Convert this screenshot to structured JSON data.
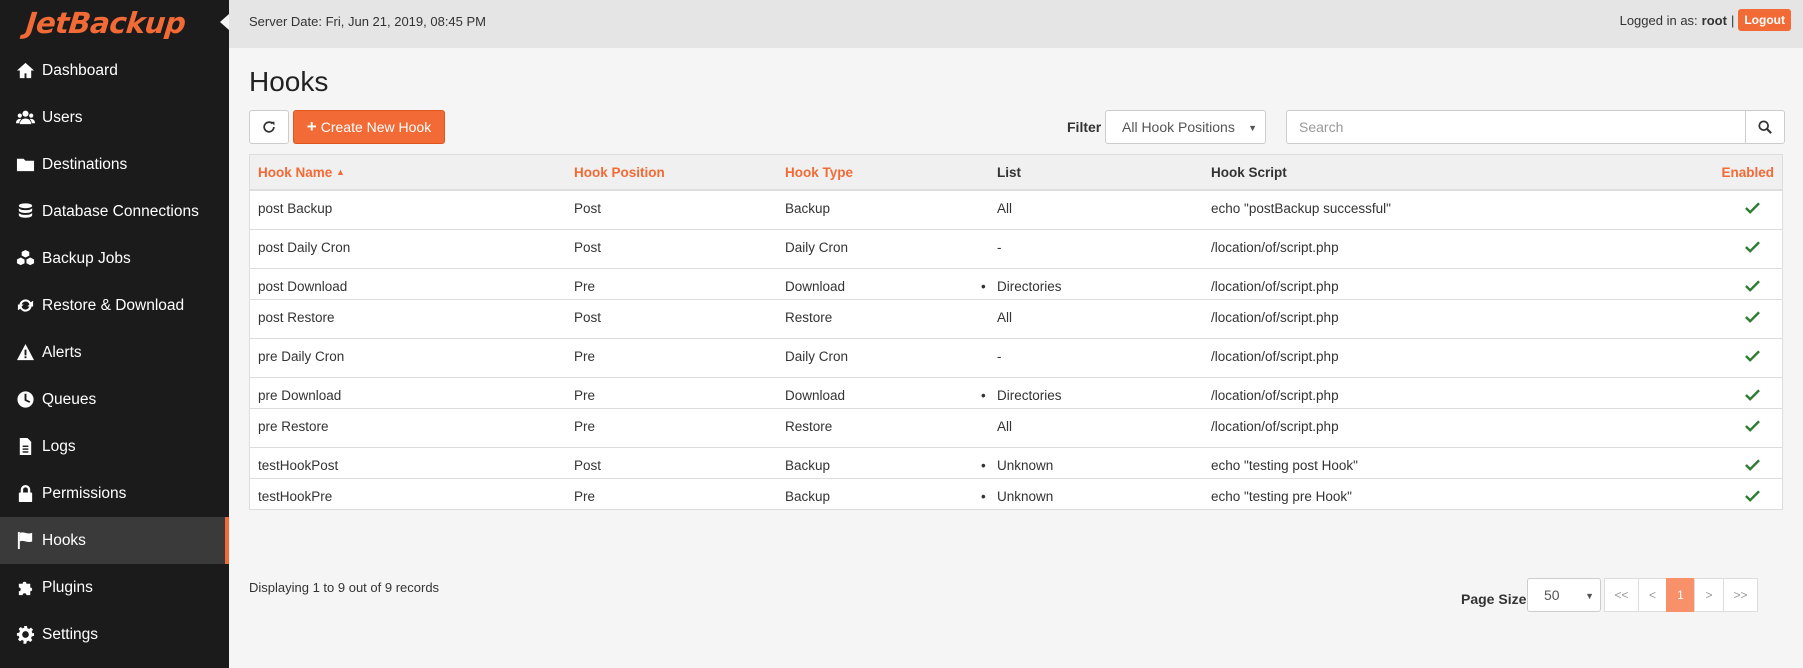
{
  "app": {
    "logo": "JetBackup"
  },
  "sidebar": {
    "items": [
      {
        "label": "Dashboard",
        "icon": "home-icon"
      },
      {
        "label": "Users",
        "icon": "users-icon"
      },
      {
        "label": "Destinations",
        "icon": "folder-icon"
      },
      {
        "label": "Database Connections",
        "icon": "database-icon"
      },
      {
        "label": "Backup Jobs",
        "icon": "cubes-icon"
      },
      {
        "label": "Restore & Download",
        "icon": "refresh-icon"
      },
      {
        "label": "Alerts",
        "icon": "warning-icon"
      },
      {
        "label": "Queues",
        "icon": "clock-icon"
      },
      {
        "label": "Logs",
        "icon": "file-icon"
      },
      {
        "label": "Permissions",
        "icon": "lock-icon"
      },
      {
        "label": "Hooks",
        "icon": "flag-icon",
        "active": true
      },
      {
        "label": "Plugins",
        "icon": "puzzle-icon"
      },
      {
        "label": "Settings",
        "icon": "gear-icon"
      }
    ]
  },
  "topbar": {
    "server_date": "Server Date: Fri, Jun 21, 2019, 08:45 PM",
    "logged_in_label": "Logged in as:",
    "user": "root",
    "separator": "|",
    "logout": "Logout"
  },
  "main": {
    "title": "Hooks",
    "create_button": "Create New Hook",
    "filter_label": "Filter",
    "filter_value": "All Hook Positions",
    "search_placeholder": "Search"
  },
  "table": {
    "columns": [
      "Hook Name",
      "Hook Position",
      "Hook Type",
      "List",
      "Hook Script",
      "Enabled"
    ],
    "rows": [
      {
        "name": "post Backup",
        "position": "Post",
        "type": "Backup",
        "list": "All",
        "list_bullet": false,
        "script": "echo \"postBackup successful\"",
        "enabled": true
      },
      {
        "name": "post Daily Cron",
        "position": "Post",
        "type": "Daily Cron",
        "list": "-",
        "list_bullet": false,
        "script": "/location/of/script.php",
        "enabled": true
      },
      {
        "name": "post Download",
        "position": "Pre",
        "type": "Download",
        "list": "Directories",
        "list_bullet": true,
        "script": "/location/of/script.php",
        "enabled": true
      },
      {
        "name": "post Restore",
        "position": "Post",
        "type": "Restore",
        "list": "All",
        "list_bullet": false,
        "script": "/location/of/script.php",
        "enabled": true
      },
      {
        "name": "pre Daily Cron",
        "position": "Pre",
        "type": "Daily Cron",
        "list": "-",
        "list_bullet": false,
        "script": "/location/of/script.php",
        "enabled": true
      },
      {
        "name": "pre Download",
        "position": "Pre",
        "type": "Download",
        "list": "Directories",
        "list_bullet": true,
        "script": "/location/of/script.php",
        "enabled": true
      },
      {
        "name": "pre Restore",
        "position": "Pre",
        "type": "Restore",
        "list": "All",
        "list_bullet": false,
        "script": "/location/of/script.php",
        "enabled": true
      },
      {
        "name": "testHookPost",
        "position": "Post",
        "type": "Backup",
        "list": "Unknown",
        "list_bullet": true,
        "script": "echo \"testing post Hook\"",
        "enabled": true
      },
      {
        "name": "testHookPre",
        "position": "Pre",
        "type": "Backup",
        "list": "Unknown",
        "list_bullet": true,
        "script": "echo \"testing pre Hook\"",
        "enabled": true
      }
    ]
  },
  "footer": {
    "records": "Displaying 1 to 9 out of 9 records",
    "page_size_label": "Page Size",
    "page_size_value": "50",
    "pager": [
      "<<",
      "<",
      "1",
      ">",
      ">>"
    ],
    "current_page": "1"
  },
  "colors": {
    "accent": "#f26a35",
    "check": "#2e7d32",
    "sidebar_bg": "#1b1b1b"
  }
}
